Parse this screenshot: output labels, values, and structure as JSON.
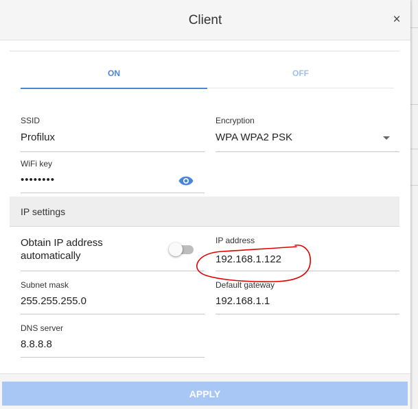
{
  "dialog": {
    "title": "Client",
    "close_label": "×"
  },
  "tabs": [
    {
      "label": "ON",
      "active": true
    },
    {
      "label": "OFF",
      "active": false
    }
  ],
  "fields": {
    "ssid": {
      "label": "SSID",
      "value": "Profilux"
    },
    "encryption": {
      "label": "Encryption",
      "value": "WPA WPA2 PSK"
    },
    "wifi_key": {
      "label": "WiFi key",
      "value": "••••••••"
    },
    "ip_address": {
      "label": "IP address",
      "value": "192.168.1.122"
    },
    "subnet_mask": {
      "label": "Subnet mask",
      "value": "255.255.255.0"
    },
    "default_gateway": {
      "label": "Default gateway",
      "value": "192.168.1.1"
    },
    "dns_server": {
      "label": "DNS server",
      "value": "8.8.8.8"
    }
  },
  "ip_settings": {
    "header": "IP settings",
    "obtain_auto_label": "Obtain IP address automatically",
    "obtain_auto_enabled": false
  },
  "apply_label": "APPLY",
  "colors": {
    "accent": "#4a86d8",
    "apply_disabled": "#a9c7f5",
    "annotation": "#e00000"
  },
  "icons": {
    "close": "close-icon",
    "password_visibility": "eye-icon",
    "dropdown": "chevron-down-icon"
  }
}
